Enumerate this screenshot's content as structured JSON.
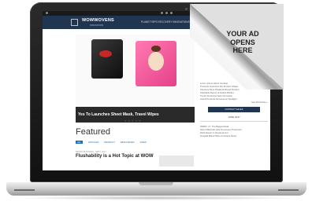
{
  "site": {
    "logo": "WOWWOVENS",
    "logo_sub": "INNOVATION",
    "nav": "PLANET   RIPS   RECOVERY   INNOVATIONS   PRODUCTS"
  },
  "hero": {
    "caption": "Yes To Launches Sheet Mask, Travel Wipes",
    "pager": "● ● ● ● ●"
  },
  "featured": {
    "heading": "Featured",
    "categories": [
      "ALL",
      "ARTICLES",
      "PRODUCT",
      "RESOURCES",
      "VIDEO"
    ],
    "meta": "BRAND BUSINESS  ·  SEPT. 2017",
    "headline": "Flushability is a Hot Topic at WOW"
  },
  "sidebar": {
    "items": [
      "Lorem ipsum wipes roundup",
      "Products Launches Pet Product Shape",
      "Cleaners More Wetlands Brand Product",
      "Flushable Report at Global Market",
      "Trend Introduces New Innovation",
      "Latest Products Nonwovens Spotlight"
    ],
    "see_all": "See All Articles »",
    "button": "CONTACT SALES",
    "section_head": "JUNE 2017",
    "bottom_items": [
      "WWDC 17: The Biggest Deal",
      "Nano Materials Help Nonwoven Producers",
      "Rolls Report in Development",
      "Hospital Brand Wipe Contracts News"
    ]
  },
  "ad": {
    "text": "YOUR AD OPENS HERE"
  }
}
